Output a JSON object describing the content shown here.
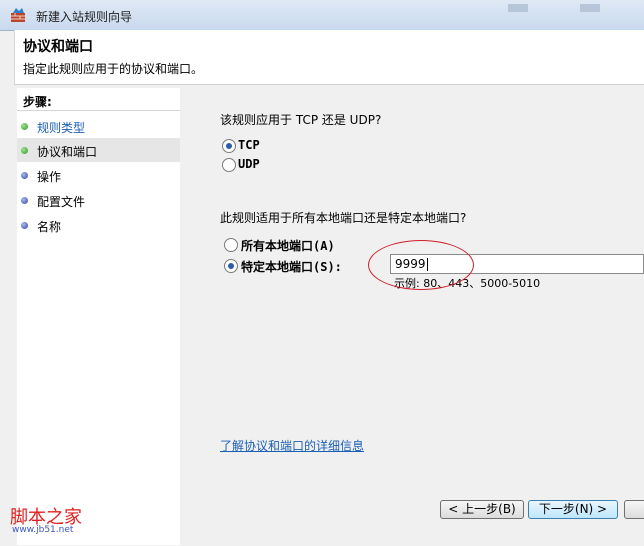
{
  "window": {
    "title": "新建入站规则向导"
  },
  "header": {
    "title": "协议和端口",
    "description": "指定此规则应用于的协议和端口。"
  },
  "steps": {
    "title": "步骤:",
    "items": [
      {
        "label": "规则类型",
        "state": "done"
      },
      {
        "label": "协议和端口",
        "state": "current"
      },
      {
        "label": "操作",
        "state": "pending"
      },
      {
        "label": "配置文件",
        "state": "pending"
      },
      {
        "label": "名称",
        "state": "pending"
      }
    ]
  },
  "protocol": {
    "question": "该规则应用于 TCP 还是 UDP?",
    "options": [
      {
        "label": "TCP",
        "checked": true
      },
      {
        "label": "UDP",
        "checked": false
      }
    ]
  },
  "ports": {
    "question": "此规则适用于所有本地端口还是特定本地端口?",
    "options": [
      {
        "label": "所有本地端口(A)",
        "checked": false
      },
      {
        "label": "特定本地端口(S):",
        "checked": true
      }
    ],
    "value": "9999",
    "example": "示例: 80、443、5000-5010"
  },
  "link": {
    "label": "了解协议和端口的详细信息"
  },
  "buttons": {
    "back": "< 上一步(B)",
    "next": "下一步(N) >"
  },
  "watermark": {
    "line1": "脚本之家",
    "line2": "www.jb51.net"
  },
  "colors": {
    "link": "#1b5fb5",
    "annotation": "#d0202a",
    "watermark_red": "#e11f1f",
    "watermark_blue": "#3a56c4"
  }
}
